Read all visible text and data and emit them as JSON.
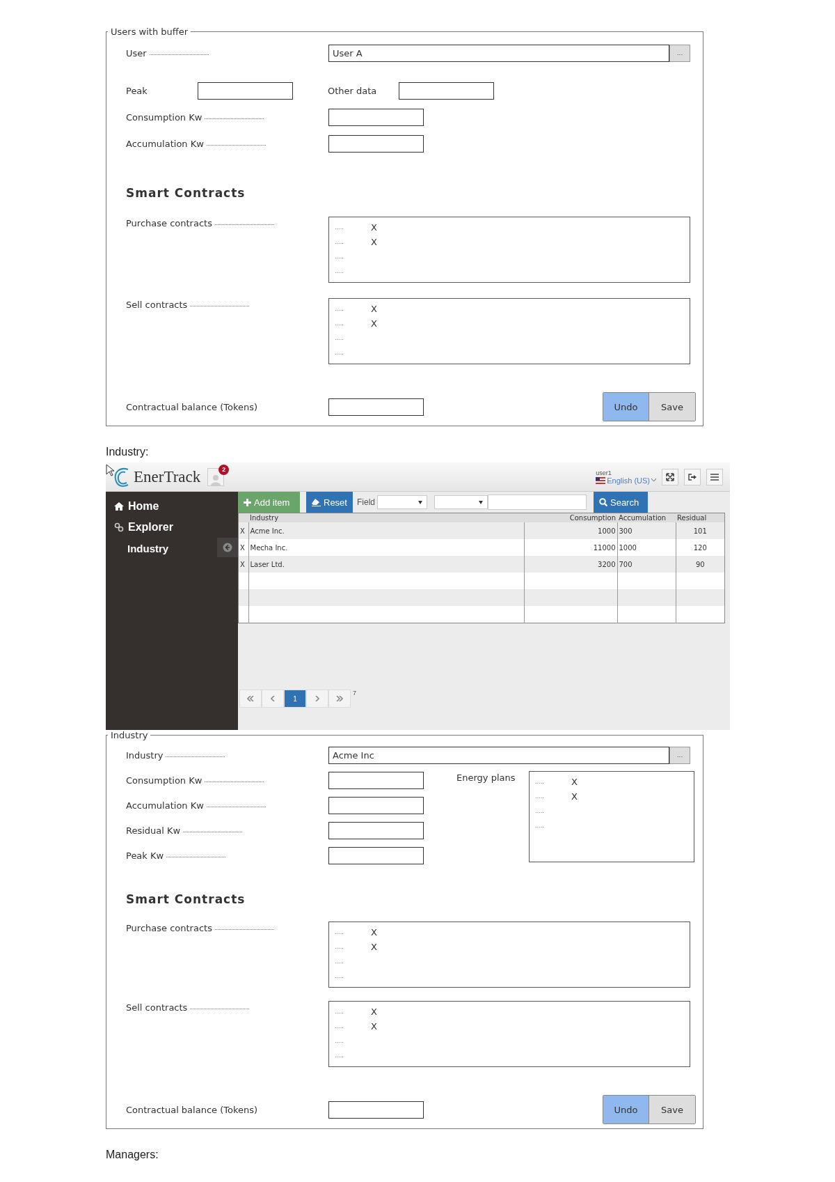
{
  "users_form": {
    "legend": "Users with buffer",
    "rows": [
      {
        "kind": "lookup",
        "label": "User",
        "leader": true,
        "value": "User A",
        "button": "..."
      },
      {
        "kind": "pair",
        "label": "Peak",
        "leader": false,
        "label_2": "Other data"
      },
      {
        "kind": "field",
        "label": "Consumption Kw",
        "leader": true
      },
      {
        "kind": "field",
        "label": "Accumulation Kw",
        "leader": true
      }
    ],
    "heading": "Smart Contracts",
    "lists": [
      {
        "label": "Purchase contracts",
        "leader": true,
        "items": [
          {
            "text": ".....",
            "mark": "X"
          },
          {
            "text": ".....",
            "mark": "X"
          },
          {
            "text": "....."
          },
          {
            "text": "....."
          }
        ]
      },
      {
        "label": "Sell contracts",
        "leader": true,
        "items": [
          {
            "text": ".....",
            "mark": "X"
          },
          {
            "text": ".....",
            "mark": "X"
          },
          {
            "text": "....."
          },
          {
            "text": "....."
          }
        ]
      }
    ],
    "balance": {
      "label": "Contractual balance (Tokens)",
      "leader": false
    },
    "buttons": [
      {
        "label": "Undo",
        "primary": true
      },
      {
        "label": "Save",
        "primary": false
      }
    ]
  },
  "industry_caption": "Industry:",
  "app": {
    "header": {
      "app_name": "EnerTrack",
      "notifications": "2",
      "user": "user1",
      "language": "English (US)"
    },
    "sidebar": {
      "items": [
        {
          "label": "Home"
        },
        {
          "label": "Explorer",
          "children": [
            {
              "label": "Industry"
            }
          ]
        }
      ]
    },
    "toolbar": {
      "add": "Add item",
      "reset": "Reset",
      "field_label": "Field",
      "search": "Search"
    },
    "table": {
      "columns": [
        "Industry",
        "Consumption",
        "Accumulation",
        "Residual"
      ],
      "rows": [
        {
          "mark": "X",
          "cells": [
            "Acme Inc.",
            "1000",
            "300",
            "101"
          ]
        },
        {
          "mark": "X",
          "cells": [
            "Mecha Inc.",
            "11000",
            "1000",
            "120"
          ]
        },
        {
          "mark": "X",
          "cells": [
            "Laser Ltd.",
            "3200",
            "700",
            "90"
          ]
        }
      ]
    },
    "pagination": {
      "pages": [
        {
          "label": "1",
          "selected": true
        }
      ],
      "total": "7"
    }
  },
  "industry_form": {
    "legend": "Industry",
    "rows": [
      {
        "kind": "lookup",
        "label": "Industry",
        "leader": true,
        "value": "Acme Inc",
        "button": "..."
      },
      {
        "kind": "field",
        "label": "Consumption Kw",
        "leader": true
      },
      {
        "kind": "field",
        "label": "Accumulation Kw",
        "leader": true
      },
      {
        "kind": "field",
        "label": "Residual Kw",
        "leader": true
      },
      {
        "kind": "field",
        "label": "Peak Kw",
        "leader": true
      }
    ],
    "side_list": {
      "label": "Energy plans",
      "items": [
        {
          "text": ".....",
          "mark": "X"
        },
        {
          "text": ".....",
          "mark": "X"
        },
        {
          "text": "....."
        },
        {
          "text": "....."
        }
      ]
    },
    "heading": "Smart Contracts",
    "lists": [
      {
        "label": "Purchase contracts",
        "leader": true,
        "items": [
          {
            "text": ".....",
            "mark": "X"
          },
          {
            "text": ".....",
            "mark": "X"
          },
          {
            "text": "....."
          },
          {
            "text": "....."
          }
        ]
      },
      {
        "label": "Sell contracts",
        "leader": true,
        "items": [
          {
            "text": ".....",
            "mark": "X"
          },
          {
            "text": ".....",
            "mark": "X"
          },
          {
            "text": "....."
          },
          {
            "text": "....."
          }
        ]
      }
    ],
    "balance": {
      "label": "Contractual balance (Tokens)",
      "leader": false
    },
    "buttons": [
      {
        "label": "Undo",
        "primary": true
      },
      {
        "label": "Save",
        "primary": false
      }
    ]
  },
  "managers_caption": "Managers:"
}
